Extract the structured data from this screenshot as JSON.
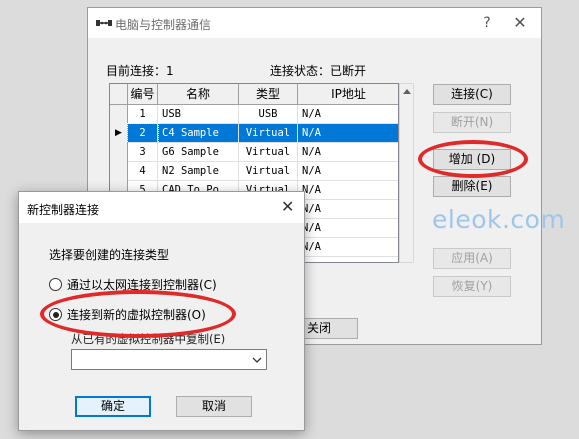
{
  "main": {
    "title": "电脑与控制器通信",
    "current_label": "目前连接：1",
    "status_label": "连接状态：已断开",
    "columns": [
      "编号",
      "名称",
      "类型",
      "IP地址"
    ],
    "rows": [
      {
        "num": "1",
        "name": "USB",
        "type": "USB",
        "ip": "N/A"
      },
      {
        "num": "2",
        "name": "C4 Sample",
        "type": "Virtual",
        "ip": "N/A"
      },
      {
        "num": "3",
        "name": "G6 Sample",
        "type": "Virtual",
        "ip": "N/A"
      },
      {
        "num": "4",
        "name": "N2 Sample",
        "type": "Virtual",
        "ip": "N/A"
      },
      {
        "num": "5",
        "name": "CAD To Po...",
        "type": "Virtual",
        "ip": "N/A"
      },
      {
        "num": "",
        "name": "",
        "type": "",
        "ip": "N/A"
      },
      {
        "num": "",
        "name": "",
        "type": "",
        "ip": "N/A"
      },
      {
        "num": "",
        "name": "",
        "type": "",
        "ip": "N/A"
      }
    ],
    "buttons": {
      "connect": "连接(C)",
      "disconnect": "断开(N)",
      "add": "增加 (D)",
      "delete": "删除(E)",
      "apply": "应用(A)",
      "restore": "恢复(Y)",
      "close": "关闭"
    }
  },
  "watermark": "eleok.com",
  "dialog": {
    "title": "新控制器连接",
    "prompt": "选择要创建的连接类型",
    "option_ethernet": "通过以太网连接到控制器(C)",
    "option_virtual": "连接到新的虚拟控制器(O)",
    "copy_label": "从已有的虚拟控制器中复制(E)",
    "copy_value": "",
    "ok": "确定",
    "cancel": "取消"
  },
  "colors": {
    "selection": "#0078d7",
    "highlight_ring": "#e02a2a",
    "watermark": "#9ec6ea"
  }
}
